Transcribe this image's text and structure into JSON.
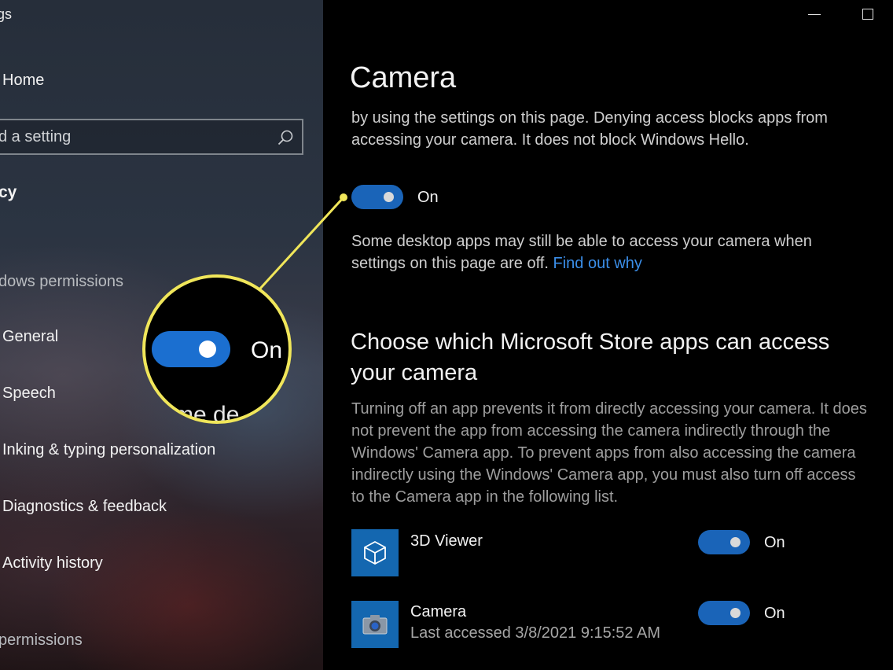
{
  "sidebar": {
    "app_title": "gs",
    "home_label": "Home",
    "search_placeholder": "d a setting",
    "section_title": "cy",
    "windows_permissions_header": "dows permissions",
    "items": [
      {
        "label": "General"
      },
      {
        "label": "Speech"
      },
      {
        "label": "Inking & typing personalization"
      },
      {
        "label": "Diagnostics & feedback"
      },
      {
        "label": "Activity history"
      }
    ],
    "app_permissions_header": "permissions"
  },
  "main": {
    "title": "Camera",
    "intro_text": "by using the settings on this page. Denying access blocks apps from accessing your camera. It does not block Windows Hello.",
    "master_toggle": {
      "state": "On",
      "on": true
    },
    "desktop_note": "Some desktop apps may still be able to access your camera when settings on this page are off.",
    "find_out_link": "Find out why",
    "store_apps_title": "Choose which Microsoft Store apps can access your camera",
    "store_apps_desc": "Turning off an app prevents it from directly accessing your camera. It does not prevent the app from accessing the camera indirectly through the Windows' Camera app. To prevent apps from also accessing the camera indirectly using the Windows' Camera app, you must also turn off access to the Camera app in the following list.",
    "apps": [
      {
        "name": "3D Viewer",
        "icon": "cube-icon",
        "toggle": "On",
        "subtitle": ""
      },
      {
        "name": "Camera",
        "icon": "camera-icon",
        "toggle": "On",
        "subtitle": "Last accessed 3/8/2021 9:15:52 AM"
      }
    ]
  },
  "callout": {
    "toggle_label": "On",
    "trail_text": "me de",
    "accent_color": "#f0e65a"
  },
  "colors": {
    "toggle_on": "#1a64b8",
    "link": "#3b8ee8",
    "tile": "#1467b0"
  }
}
